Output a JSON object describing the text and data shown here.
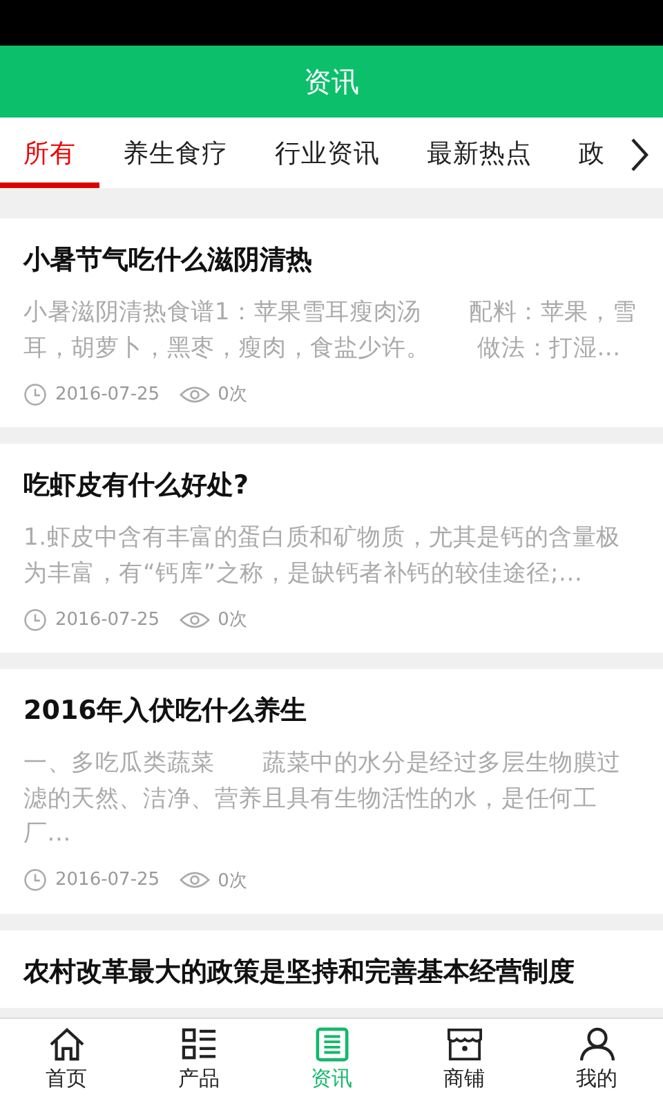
{
  "header": {
    "title": "资讯"
  },
  "tabs": [
    {
      "label": "所有",
      "selected": true
    },
    {
      "label": "养生食疗",
      "selected": false
    },
    {
      "label": "行业资讯",
      "selected": false
    },
    {
      "label": "最新热点",
      "selected": false
    },
    {
      "label": "政",
      "selected": false
    }
  ],
  "articles": [
    {
      "title": "小暑节气吃什么滋阴清热",
      "summary": "小暑滋阴清热食谱1：苹果雪耳瘦肉汤　　配料：苹果，雪耳，胡萝卜，黑枣，瘦肉，食盐少许。　　做法：打湿...",
      "date": "2016-07-25",
      "views": "0次"
    },
    {
      "title": "吃虾皮有什么好处?",
      "summary": "1.虾皮中含有丰富的蛋白质和矿物质，尤其是钙的含量极为丰富，有“钙库”之称，是缺钙者补钙的较佳途径;...",
      "date": "2016-07-25",
      "views": "0次"
    },
    {
      "title": "2016年入伏吃什么养生",
      "summary": "一、多吃瓜类蔬菜　　蔬菜中的水分是经过多层生物膜过滤的天然、洁净、营养且具有生物活性的水，是任何工厂...",
      "date": "2016-07-25",
      "views": "0次"
    },
    {
      "title": "农村改革最大的政策是坚持和完善基本经营制度"
    }
  ],
  "bottom_nav": [
    {
      "label": "首页",
      "kind": "home",
      "selected": false
    },
    {
      "label": "产品",
      "kind": "list",
      "selected": false
    },
    {
      "label": "资讯",
      "kind": "news",
      "selected": true
    },
    {
      "label": "商铺",
      "kind": "shop",
      "selected": false
    },
    {
      "label": "我的",
      "kind": "user",
      "selected": false
    }
  ]
}
